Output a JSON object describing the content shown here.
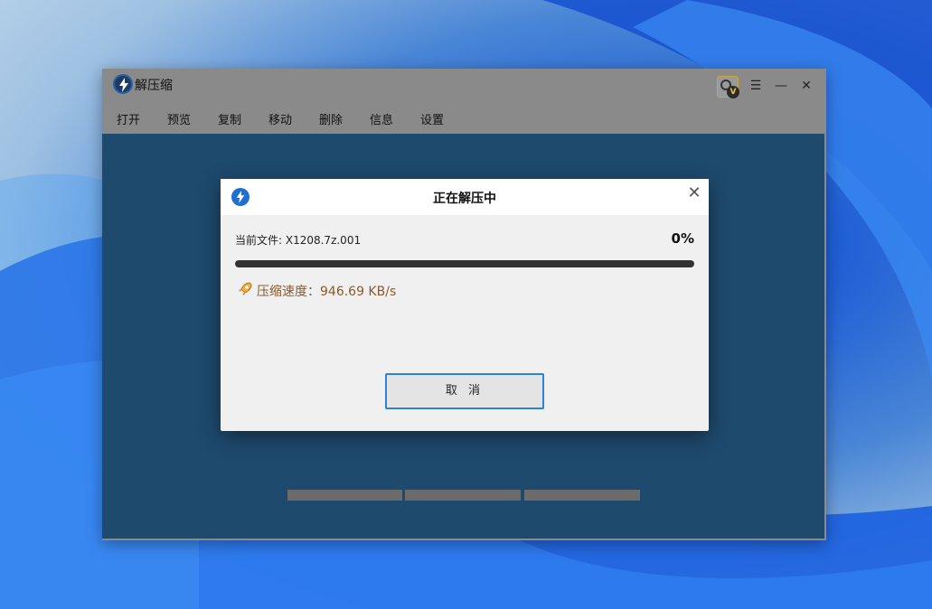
{
  "app": {
    "title": "解压缩",
    "skin_badge": "V"
  },
  "toolbar": {
    "items": [
      "打开",
      "预览",
      "复制",
      "移动",
      "删除",
      "信息",
      "设置"
    ]
  },
  "dialog": {
    "title": "正在解压中",
    "current_file": "当前文件: X1208.7z.001",
    "percent": "0%",
    "progress": 0,
    "speed": "压缩速度：946.69 KB/s",
    "cancel_label": "取 消"
  },
  "colors": {
    "accent": "#1f6fd0",
    "speed_text": "#8a5a2a",
    "content_bg": "#1e4a6e"
  }
}
